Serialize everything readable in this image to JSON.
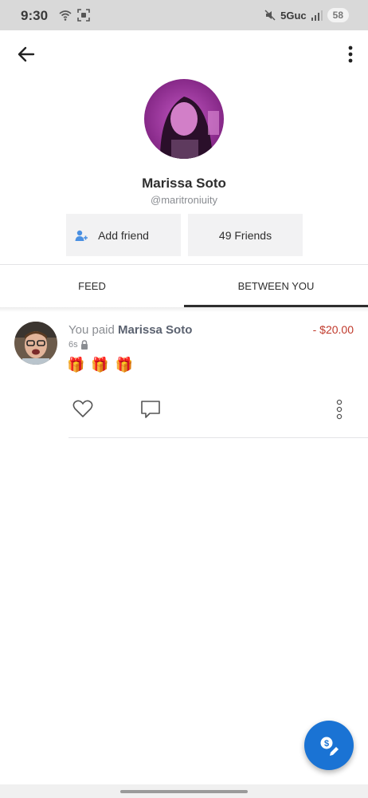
{
  "status_bar": {
    "time": "9:30",
    "network": "5Guc",
    "battery": "58",
    "icons": [
      "wifi-calling-icon",
      "screenshot-icon",
      "mute-icon",
      "signal-icon"
    ]
  },
  "header": {
    "back_icon": "back-arrow-icon",
    "more_icon": "more-vertical-icon"
  },
  "profile": {
    "name": "Marissa Soto",
    "handle": "@maritroniuity",
    "add_friend_label": "Add friend",
    "friends_label": "49 Friends"
  },
  "tabs": [
    {
      "label": "FEED",
      "active": false
    },
    {
      "label": "BETWEEN YOU",
      "active": true
    }
  ],
  "feed": {
    "items": [
      {
        "prefix": "You paid ",
        "recipient": "Marissa Soto",
        "amount": "- $20.00",
        "time": "6s",
        "privacy": "lock-icon",
        "note_emojis": [
          "🎁",
          "🎁",
          "🎁"
        ]
      }
    ]
  },
  "colors": {
    "accent": "#1a73d4",
    "negative_amount": "#c0392b",
    "muted_text": "#8a8d92"
  },
  "fab": {
    "icon": "pay-request-icon"
  }
}
